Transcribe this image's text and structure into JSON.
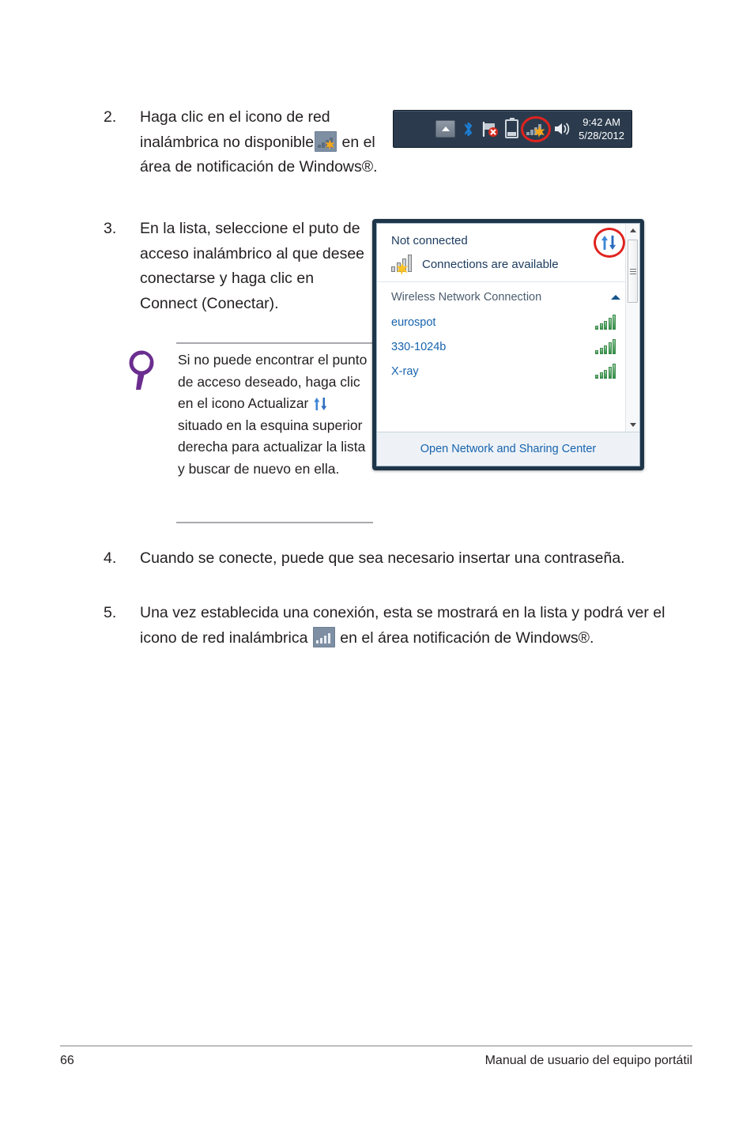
{
  "document": {
    "steps": [
      {
        "number": "2.",
        "text_before": "Haga clic en el icono de red inalámbrica no disponible",
        "icon": "wireless-unavailable-icon",
        "text_after": "en el área de notificación de Windows®."
      },
      {
        "number": "3.",
        "text": "En la lista, seleccione el puto de acceso inalámbrico al que desee conectarse y haga clic en Connect (Conectar)."
      },
      {
        "number": "4.",
        "text": "Cuando se conecte, puede que sea necesario insertar una contraseña."
      },
      {
        "number": "5.",
        "text_before": "Una vez establecida una conexión, esta se mostrará en la lista y podrá ver el icono de red inalámbrica",
        "icon": "wireless-connected-icon",
        "text_after": "en el área notificación de Windows®."
      }
    ],
    "note": {
      "icon": "magnifier-tip-icon",
      "text_before": "Si no puede encontrar el punto de acceso deseado, haga clic en el icono Actualizar",
      "inline_icon": "refresh-icon",
      "text_after": "situado en la esquina superior derecha para actualizar la lista y buscar de nuevo en ella."
    }
  },
  "taskbar": {
    "show_hidden_icons": "show-hidden-icons-button",
    "icons": [
      "bluetooth-icon",
      "network-flag-error-icon",
      "battery-icon",
      "wireless-unavailable-icon",
      "speaker-icon"
    ],
    "clock": {
      "time": "9:42 AM",
      "date": "5/28/2012"
    },
    "annotation": "red-circle-highlight"
  },
  "network_panel": {
    "status_title": "Not connected",
    "availability_text": "Connections are available",
    "refresh_icon": "refresh-icon",
    "refresh_annotation": "red-circle-highlight",
    "connection_group": {
      "label": "Wireless Network Connection",
      "collapse_icon": "chevron-up-icon"
    },
    "networks": [
      {
        "ssid": "eurospot",
        "signal": 5
      },
      {
        "ssid": "330-1024b",
        "signal": 5
      },
      {
        "ssid": "X-ray",
        "signal": 5
      }
    ],
    "footer_link": "Open Network and Sharing Center",
    "scrollbar": {
      "up_icon": "scroll-up-arrow-icon",
      "down_icon": "scroll-down-arrow-icon"
    }
  },
  "page_footer": {
    "page_number": "66",
    "manual_title": "Manual de usuario del equipo portátil"
  },
  "colors": {
    "link_blue": "#1763ad",
    "highlight_red": "#e0231f",
    "tip_purple": "#6b2d8f",
    "signal_green": "#2f8f43",
    "taskbar_bg": "#2b3b4d"
  }
}
